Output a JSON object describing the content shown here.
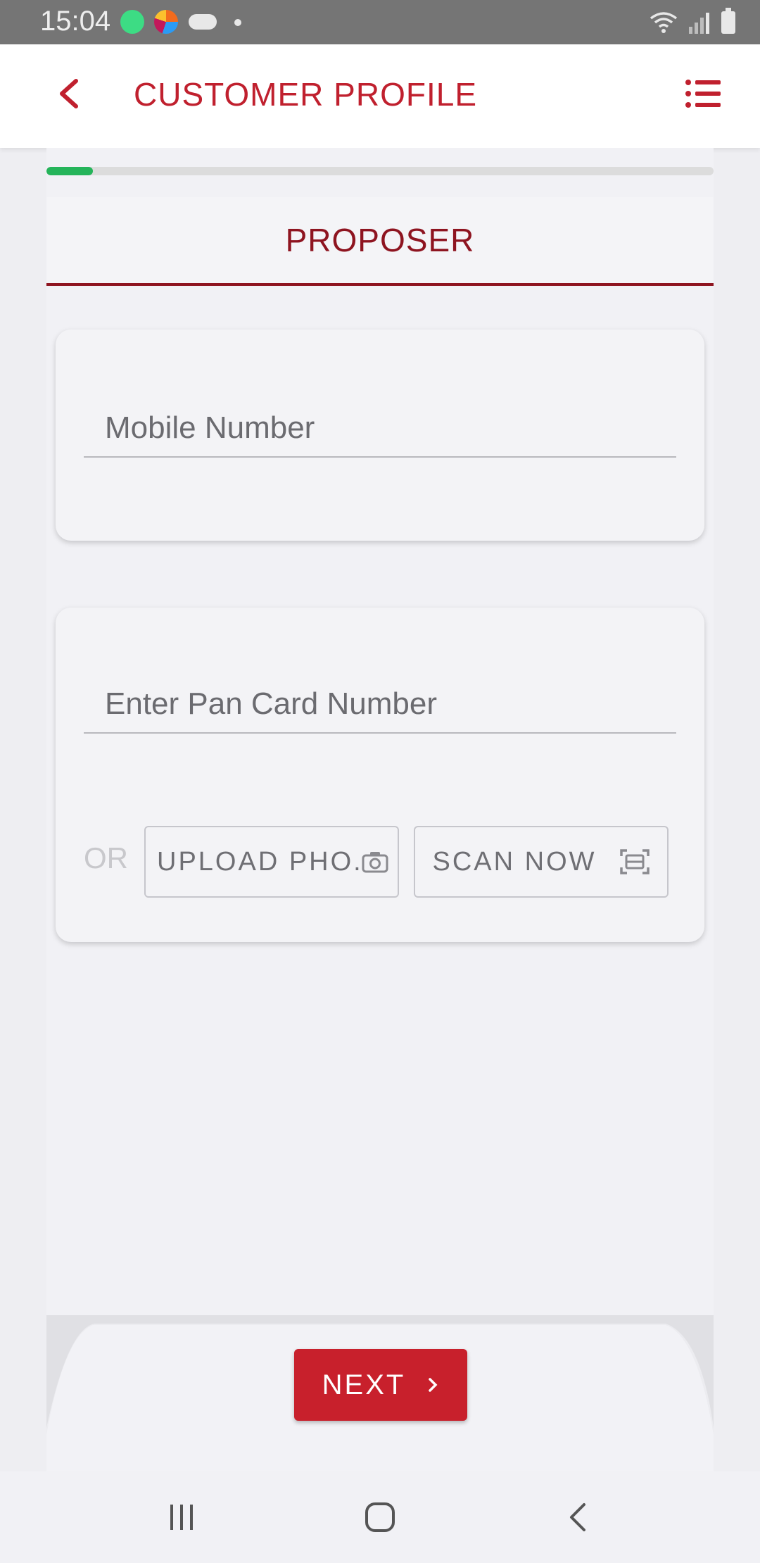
{
  "status_bar": {
    "time": "15:04"
  },
  "app_bar": {
    "title": "CUSTOMER PROFILE",
    "accent_color": "#c0202e"
  },
  "progress": {
    "fraction": 0.07,
    "color": "#25b45a"
  },
  "tab": {
    "label": "PROPOSER"
  },
  "mobile_card": {
    "placeholder": "Mobile Number"
  },
  "pan_card": {
    "placeholder": "Enter Pan Card Number",
    "or_label": "OR",
    "upload_label": "UPLOAD PHO...",
    "scan_label": "SCAN NOW"
  },
  "footer": {
    "next_label": "NEXT",
    "button_color": "#c8202c"
  },
  "icons": [
    "back-icon",
    "menu-list-icon",
    "camera-icon",
    "scan-icon",
    "chevron-right-icon",
    "recents-icon",
    "home-icon",
    "nav-back-icon"
  ]
}
